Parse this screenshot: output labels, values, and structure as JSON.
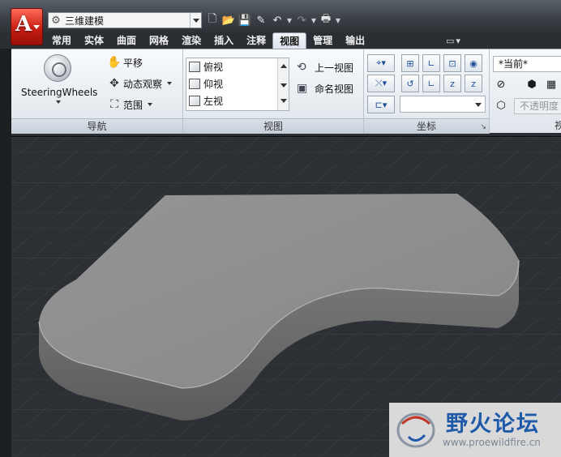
{
  "workspace": {
    "name": "三维建模"
  },
  "tabs": [
    {
      "label": "常用",
      "active": false
    },
    {
      "label": "实体",
      "active": false
    },
    {
      "label": "曲面",
      "active": false
    },
    {
      "label": "网格",
      "active": false
    },
    {
      "label": "渲染",
      "active": false
    },
    {
      "label": "插入",
      "active": false
    },
    {
      "label": "注释",
      "active": false
    },
    {
      "label": "视图",
      "active": true
    },
    {
      "label": "管理",
      "active": false
    },
    {
      "label": "输出",
      "active": false
    }
  ],
  "panels": {
    "navigation": {
      "title": "导航",
      "steering_label": "SteeringWheels",
      "pan_label": "平移",
      "orbit_label": "动态观察",
      "extents_label": "范围"
    },
    "view": {
      "title": "视图",
      "list": [
        "俯视",
        "仰视",
        "左视"
      ],
      "prev_view_label": "上一视图",
      "named_views_label": "命名视图"
    },
    "coords": {
      "title": "坐标"
    },
    "visual": {
      "current_label": "*当前*",
      "opaque_label": "不透明度",
      "title": "视"
    }
  },
  "watermark": {
    "title": "野火论坛",
    "url": "www.proewildfire.cn"
  },
  "colors": {
    "accent_red": "#c81e12",
    "viewport_bg": "#2c3035",
    "solid_top": "#8e8e8e",
    "solid_side": "#6e6e6e",
    "watermark_blue": "#1f5aa8"
  },
  "icons": {
    "app": "autocad-logo-icon",
    "new": "new-file-icon",
    "open": "open-folder-icon",
    "save": "save-icon",
    "undo": "undo-icon",
    "redo": "redo-icon",
    "plot": "print-icon"
  }
}
